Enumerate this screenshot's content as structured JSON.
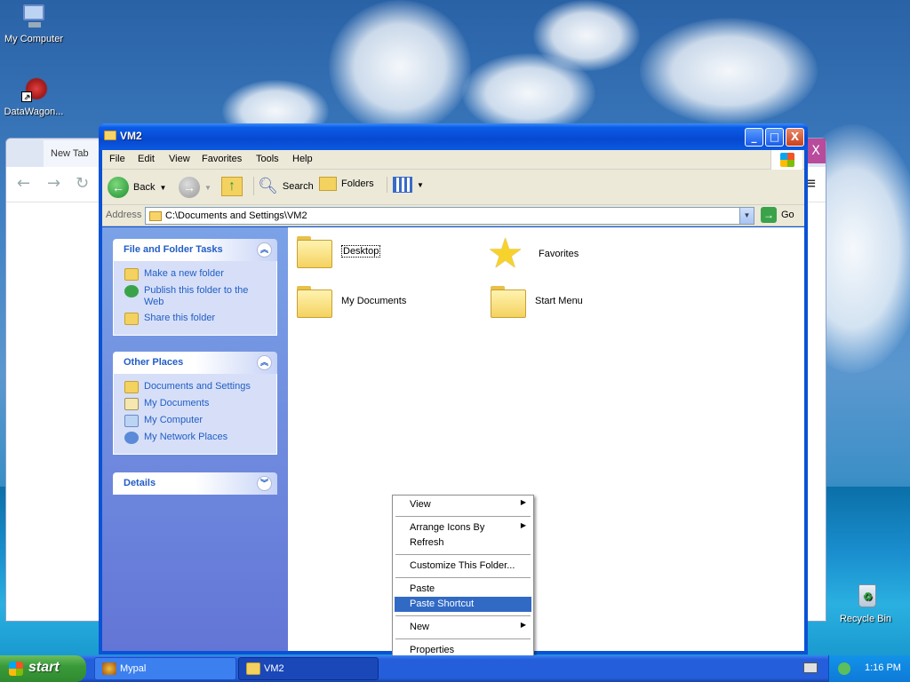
{
  "desktop": {
    "icons": [
      {
        "label": "My Computer",
        "icon": "my-computer-icon"
      },
      {
        "label": "DataWagon...",
        "icon": "datawagon-icon"
      },
      {
        "label": "Recycle Bin",
        "icon": "recycle-bin-icon"
      }
    ]
  },
  "background_browser": {
    "tab_title": "New Tab",
    "close_glyph": "X"
  },
  "window": {
    "title": "VM2",
    "controls": {
      "minimize": "_",
      "maximize": "□",
      "close": "X"
    },
    "menu": [
      "File",
      "Edit",
      "View",
      "Favorites",
      "Tools",
      "Help"
    ],
    "toolbar": {
      "back": "Back",
      "search": "Search",
      "folders": "Folders"
    },
    "address": {
      "label": "Address",
      "value": "C:\\Documents and Settings\\VM2",
      "go": "Go"
    }
  },
  "left_pane": {
    "file_tasks": {
      "title": "File and Folder Tasks",
      "items": [
        "Make a new folder",
        "Publish this folder to the Web",
        "Share this folder"
      ]
    },
    "other_places": {
      "title": "Other Places",
      "items": [
        "Documents and Settings",
        "My Documents",
        "My Computer",
        "My Network Places"
      ]
    },
    "details": {
      "title": "Details"
    }
  },
  "folders": [
    {
      "label": "Desktop",
      "icon": "folder-icon"
    },
    {
      "label": "Favorites",
      "icon": "favorites-star-icon"
    },
    {
      "label": "My Documents",
      "icon": "folder-icon"
    },
    {
      "label": "Start Menu",
      "icon": "folder-icon"
    }
  ],
  "context_menu": {
    "items": [
      {
        "label": "View",
        "submenu": true
      },
      {
        "label": "Arrange Icons By",
        "submenu": true
      },
      {
        "label": "Refresh",
        "submenu": false
      },
      {
        "label": "Customize This Folder...",
        "submenu": false
      },
      {
        "label": "Paste",
        "submenu": false
      },
      {
        "label": "Paste Shortcut",
        "submenu": false,
        "selected": true
      },
      {
        "label": "New",
        "submenu": true
      },
      {
        "label": "Properties",
        "submenu": false
      }
    ]
  },
  "taskbar": {
    "start": "start",
    "items": [
      "Mypal",
      "VM2"
    ],
    "clock": "1:16 PM"
  },
  "colors": {
    "xp_blue": "#0a52d6",
    "menu_highlight": "#316ac5",
    "link_blue": "#215dc6",
    "start_green": "#3a9a3a"
  }
}
